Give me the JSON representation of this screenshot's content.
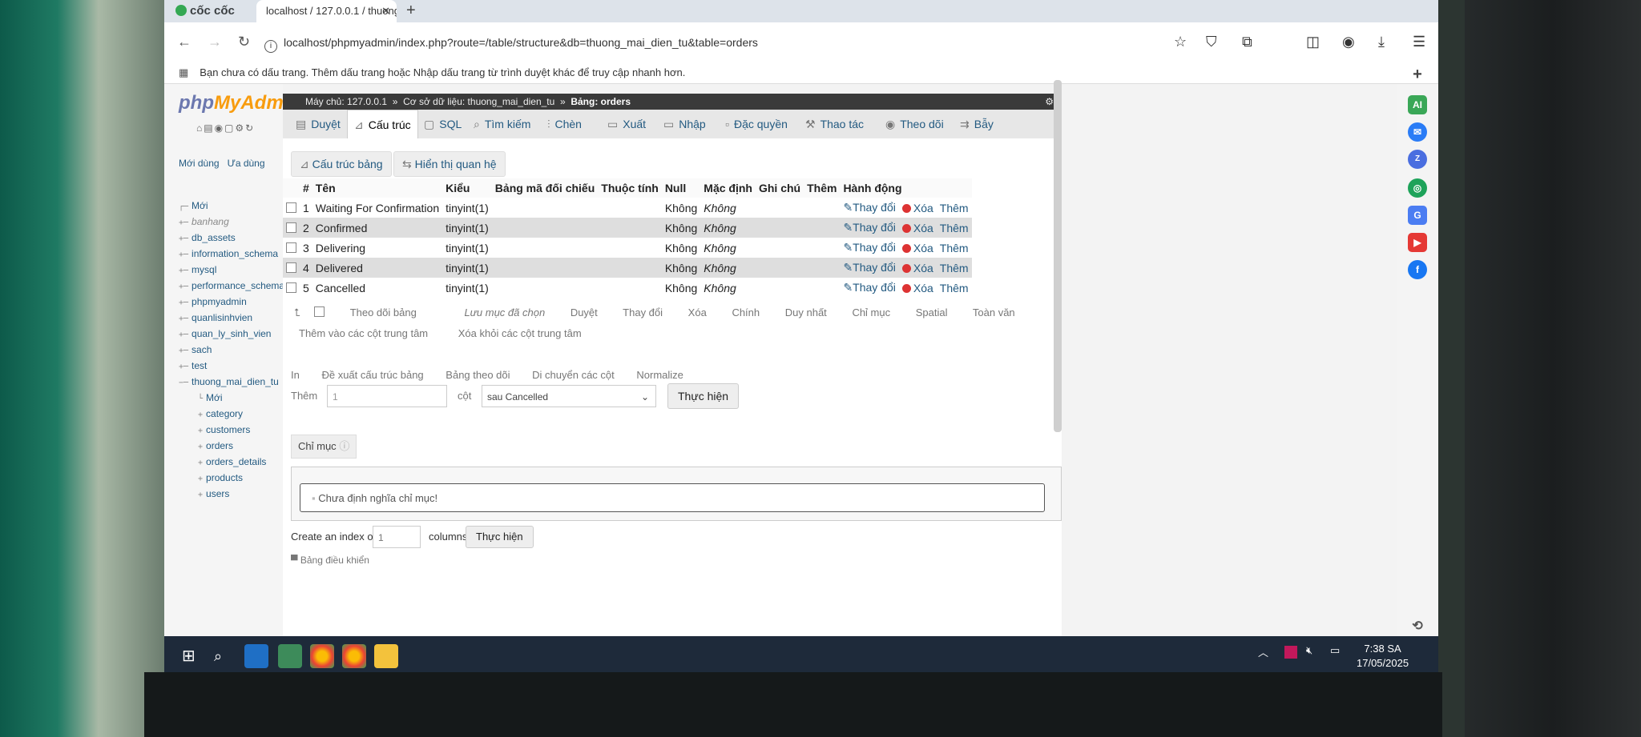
{
  "browser": {
    "brand": "cốc cốc",
    "tab_title": "localhost / 127.0.0.1 / thuong",
    "url": "localhost/phpmyadmin/index.php?route=/table/structure&db=thuong_mai_dien_tu&table=orders",
    "bookmark_notice": "Bạn chưa có dấu trang. Thêm dấu trang hoặc Nhập dấu trang từ trình duyệt khác để truy cập nhanh hơn."
  },
  "sidebar": {
    "logo_php": "php",
    "logo_myadmin": "MyAdmin",
    "links": [
      "Mới dùng",
      "Ưa dùng"
    ],
    "databases": [
      "Mới",
      "banhang",
      "db_assets",
      "information_schema",
      "mysql",
      "performance_schema",
      "phpmyadmin",
      "quanlisinhvien",
      "quan_ly_sinh_vien",
      "sach",
      "test",
      "thuong_mai_dien_tu"
    ],
    "tables": [
      "Mới",
      "category",
      "customers",
      "orders",
      "orders_details",
      "products",
      "users"
    ]
  },
  "breadcrumb": {
    "server": "Máy chủ: 127.0.0.1",
    "database": "Cơ sở dữ liệu: thuong_mai_dien_tu",
    "table": "Bảng: orders"
  },
  "menu": [
    "Duyệt",
    "Cấu trúc",
    "SQL",
    "Tìm kiếm",
    "Chèn",
    "Xuất",
    "Nhập",
    "Đặc quyền",
    "Thao tác",
    "Theo dõi",
    "Bẫy"
  ],
  "subtabs": [
    "Cấu trúc bảng",
    "Hiển thị quan hệ"
  ],
  "structure": {
    "headers": [
      "#",
      "Tên",
      "Kiểu",
      "Bảng mã đối chiếu",
      "Thuộc tính",
      "Null",
      "Mặc định",
      "Ghi chú",
      "Thêm",
      "Hành động"
    ],
    "rows": [
      {
        "num": "1",
        "name": "Waiting For Confirmation",
        "type": "tinyint(1)",
        "null": "Không",
        "default": "Không"
      },
      {
        "num": "2",
        "name": "Confirmed",
        "type": "tinyint(1)",
        "null": "Không",
        "default": "Không"
      },
      {
        "num": "3",
        "name": "Delivering",
        "type": "tinyint(1)",
        "null": "Không",
        "default": "Không"
      },
      {
        "num": "4",
        "name": "Delivered",
        "type": "tinyint(1)",
        "null": "Không",
        "default": "Không"
      },
      {
        "num": "5",
        "name": "Cancelled",
        "type": "tinyint(1)",
        "null": "Không",
        "default": "Không"
      }
    ],
    "actions": [
      "Thay đổi",
      "Xóa",
      "Thêm"
    ]
  },
  "bulk": {
    "check_all": "Theo dõi bảng",
    "with_selected": "Lưu mục đã chọn",
    "items": [
      "Duyệt",
      "Thay đổi",
      "Xóa",
      "Chính",
      "Duy nhất",
      "Chỉ mục",
      "Spatial",
      "Toàn văn"
    ],
    "items2": [
      "Thêm vào các cột trung tâm",
      "Xóa khỏi các cột trung tâm"
    ]
  },
  "tools": [
    "In",
    "Đề xuất cấu trúc bảng",
    "Bảng theo dõi",
    "Di chuyển các cột",
    "Normalize"
  ],
  "add_columns": {
    "label": "Thêm",
    "count": "1",
    "unit": "cột",
    "position": "sau Cancelled",
    "submit": "Thực hiện"
  },
  "indexes": {
    "tab": "Chỉ mục",
    "empty": "Chưa định nghĩa chỉ mục!",
    "create_label": "Create an index on",
    "create_count": "1",
    "create_unit": "columns",
    "submit": "Thực hiện"
  },
  "console": "Bảng điều khiển",
  "clock": {
    "time": "7:38 SA",
    "date": "17/05/2025"
  },
  "colors": {
    "link": "#235a81",
    "accent_orange": "#f89c0e",
    "logo_blue": "#6c78af"
  }
}
